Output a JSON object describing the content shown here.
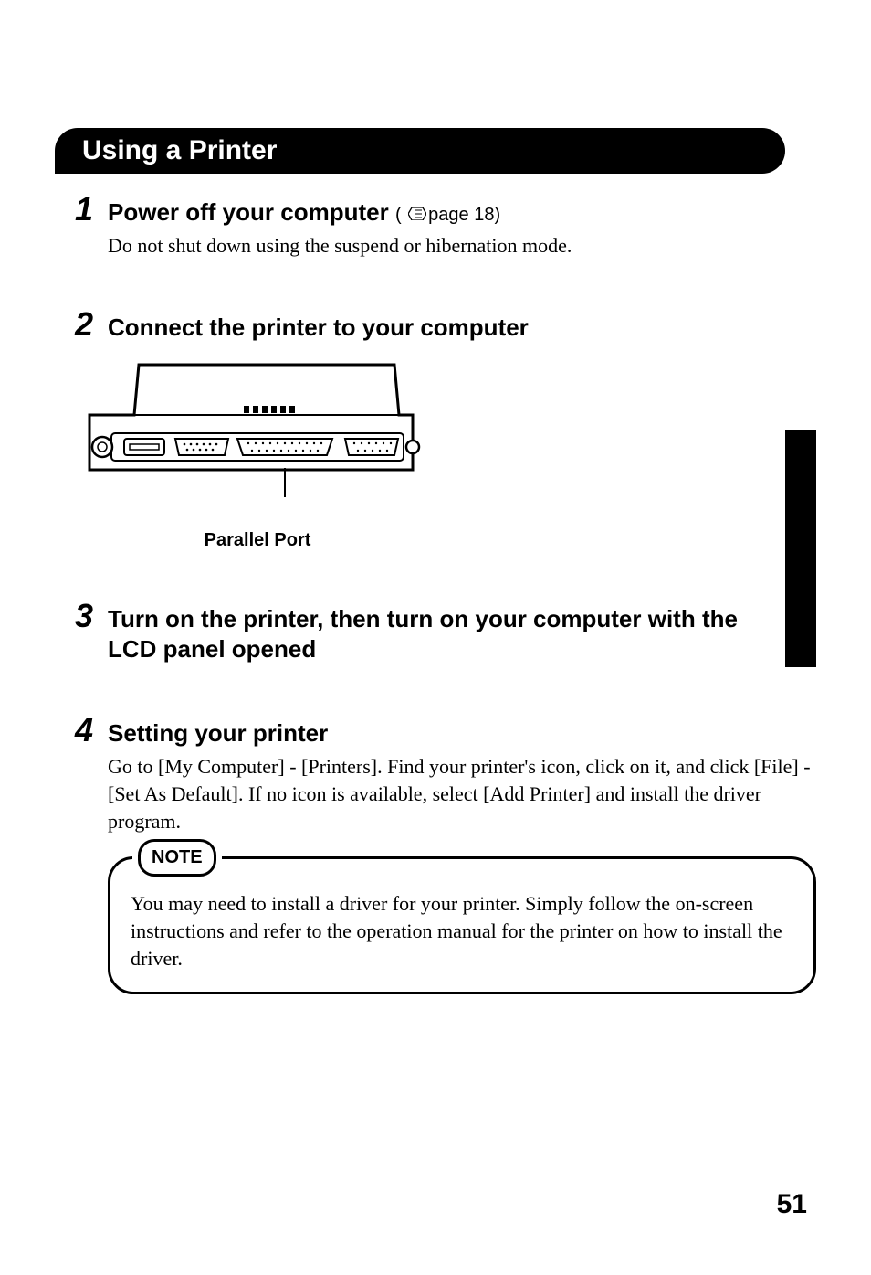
{
  "heading": "Using a Printer",
  "steps": [
    {
      "num": "1",
      "title": "Power off your computer",
      "ref_prefix": "( ",
      "ref_text": "page 18)",
      "body": "Do not shut down using the suspend or hibernation mode."
    },
    {
      "num": "2",
      "title": "Connect the printer to your computer",
      "illus_caption": "Parallel Port"
    },
    {
      "num": "3",
      "title": "Turn on the printer, then turn on your computer with the LCD panel opened"
    },
    {
      "num": "4",
      "title": "Setting your printer",
      "body": "Go to [My Computer] - [Printers]. Find your printer's icon, click on it, and click [File] - [Set As Default]. If no icon is available, select [Add Printer] and install the driver program."
    }
  ],
  "note_label": "NOTE",
  "note_text": "You may need to install a driver for your printer. Simply follow the on-screen instructions and refer to the operation manual for the printer on how to install the driver.",
  "page_number": "51"
}
